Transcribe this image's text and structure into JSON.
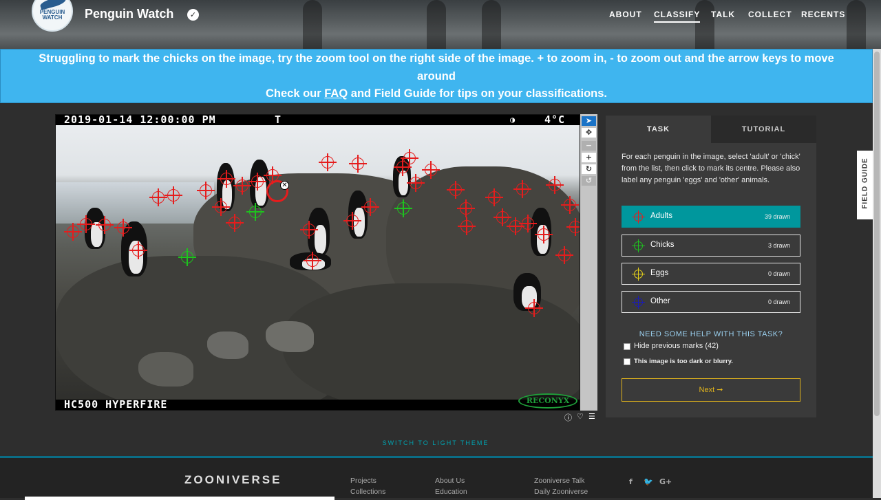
{
  "header": {
    "logo_text": "PENGUIN WATCH",
    "title": "Penguin Watch",
    "verified_icon": "check-badge-icon",
    "nav": [
      "ABOUT",
      "CLASSIFY",
      "TALK",
      "COLLECT",
      "RECENTS"
    ],
    "active_nav": "CLASSIFY"
  },
  "banner": {
    "line1": "Struggling to mark the chicks on the image, try the zoom tool on the right side of the image. + to zoom in, - to zoom out and the arrow keys to move",
    "line2": "around",
    "line3_pre": "Check our ",
    "faq_link": "FAQ",
    "line3_post": " and Field Guide for tips on your classifications."
  },
  "subject": {
    "timestamp": "2019-01-14 12:00:00 PM",
    "t_flag": "T",
    "moon_icon": "moon-phase-icon",
    "temperature": "4°C",
    "camera_model": "HC500 HYPERFIRE",
    "brand": "RECONYX"
  },
  "toolbar": {
    "icons": [
      "pointer-icon",
      "move-icon",
      "zoom-out-icon",
      "zoom-in-icon",
      "rotate-icon",
      "reset-icon"
    ],
    "symbols": [
      "➤",
      "✥",
      "−",
      "+",
      "↻",
      "↺"
    ]
  },
  "subject_meta_icons": [
    "info-icon",
    "favorite-icon",
    "collections-icon"
  ],
  "panel": {
    "tab_task": "TASK",
    "tab_tutorial": "TUTORIAL",
    "instructions": "For each penguin in the image, select 'adult' or 'chick' from the list, then click to mark its centre. Please also label any penguin 'eggs' and 'other' animals.",
    "tools": [
      {
        "label": "Adults",
        "count": "39 drawn",
        "color": "#e51d1d"
      },
      {
        "label": "Chicks",
        "count": "3 drawn",
        "color": "#1ec21e"
      },
      {
        "label": "Eggs",
        "count": "0 drawn",
        "color": "#e6d21a"
      },
      {
        "label": "Other",
        "count": "0 drawn",
        "color": "#1b1bb8"
      }
    ],
    "help": "NEED SOME HELP WITH THIS TASK?",
    "hide_marks": "Hide previous marks (42)",
    "too_dark": "This image is too dark or blurry.",
    "next": "Next ➞"
  },
  "field_guide": "FIELD GUIDE",
  "switch_theme": "SWITCH TO LIGHT THEME",
  "footer": {
    "brand": "ZOONIVERSE",
    "col1": [
      "Projects",
      "Collections"
    ],
    "col2": [
      "About Us",
      "Education"
    ],
    "col3": [
      "Zooniverse Talk",
      "Daily Zooniverse"
    ],
    "social": [
      "f",
      "🐦",
      "G+"
    ]
  }
}
